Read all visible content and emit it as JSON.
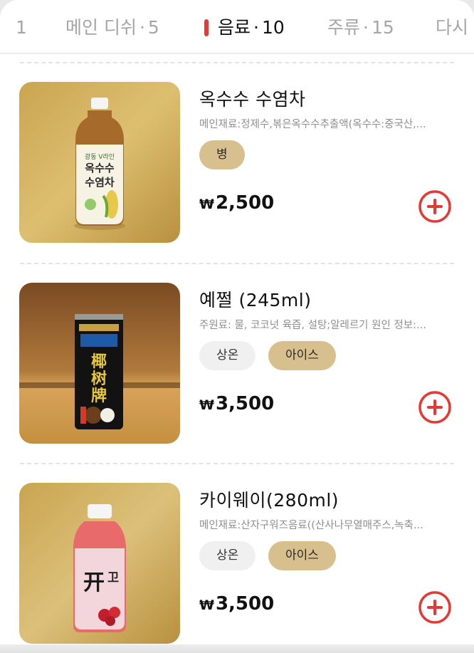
{
  "tabs": [
    {
      "label": "1",
      "count": ""
    },
    {
      "label": "메인 디쉬",
      "count": "5"
    },
    {
      "label": "음료",
      "count": "10"
    },
    {
      "label": "주류",
      "count": "15"
    },
    {
      "label": "다시",
      "count": ""
    }
  ],
  "active_tab_index": 2,
  "tab_separator": "·",
  "currency_symbol": "₩",
  "items": [
    {
      "name": "옥수수 수염차",
      "description": "메인재료:정제수,볶은옥수수추출액(옥수수:중국산,...",
      "options": [
        {
          "label": "병",
          "style": "gold"
        }
      ],
      "price": "2,500",
      "image_label": "옥수수 수염차 bottle"
    },
    {
      "name": "예쩔 (245ml)",
      "description": "주원료: 물, 코코넛 육즙, 설탕;알레르기 원인 정보:...",
      "options": [
        {
          "label": "상온",
          "style": "gray"
        },
        {
          "label": "아이스",
          "style": "gold"
        }
      ],
      "price": "3,500",
      "image_label": "coconut juice can"
    },
    {
      "name": "카이웨이(280ml)",
      "description": "메인재료:산자구워즈음료((산사나무열매주스,녹축...",
      "options": [
        {
          "label": "상온",
          "style": "gray"
        },
        {
          "label": "아이스",
          "style": "gold"
        }
      ],
      "price": "3,500",
      "image_label": "hawthorn drink bottle"
    }
  ],
  "colors": {
    "accent_red": "#e53935",
    "option_gold": "#d7c08d",
    "option_gray": "#f0f0f0",
    "muted_text": "#8f8f8f"
  },
  "icons": [
    "add-circle-icon"
  ]
}
